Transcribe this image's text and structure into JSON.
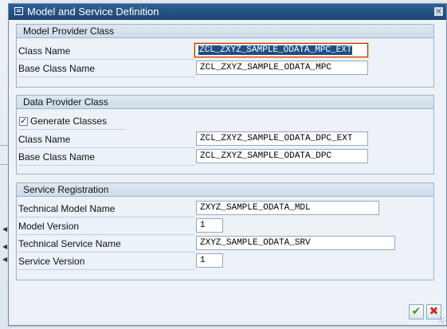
{
  "dialog": {
    "title": "Model and Service Definition",
    "close_glyph": "×"
  },
  "model_provider": {
    "header": "Model Provider Class",
    "class_name_label": "Class Name",
    "class_name_value": "ZCL_ZXYZ_SAMPLE_ODATA_MPC_EXT",
    "base_class_label": "Base Class Name",
    "base_class_value": "ZCL_ZXYZ_SAMPLE_ODATA_MPC"
  },
  "data_provider": {
    "header": "Data Provider Class",
    "generate_label": "Generate Classes",
    "generate_checked": "✓",
    "class_name_label": "Class Name",
    "class_name_value": "ZCL_ZXYZ_SAMPLE_ODATA_DPC_EXT",
    "base_class_label": "Base Class Name",
    "base_class_value": "ZCL_ZXYZ_SAMPLE_ODATA_DPC"
  },
  "service_registration": {
    "header": "Service Registration",
    "tech_model_label": "Technical Model Name",
    "tech_model_value": "ZXYZ_SAMPLE_ODATA_MDL",
    "model_version_label": "Model Version",
    "model_version_value": "1",
    "tech_service_label": "Technical Service Name",
    "tech_service_value": "ZXYZ_SAMPLE_ODATA_SRV",
    "service_version_label": "Service Version",
    "service_version_value": "1"
  },
  "footer": {
    "ok_glyph": "✔",
    "cancel_glyph": "✖"
  },
  "icons": [
    "app-icon",
    "close-icon",
    "checkmark-icon",
    "cancel-icon"
  ],
  "colors": {
    "title_bar": "#1d4575",
    "ok_green": "#3e9a1a",
    "cancel_red": "#c8341c",
    "selection": "#1f4e85"
  }
}
